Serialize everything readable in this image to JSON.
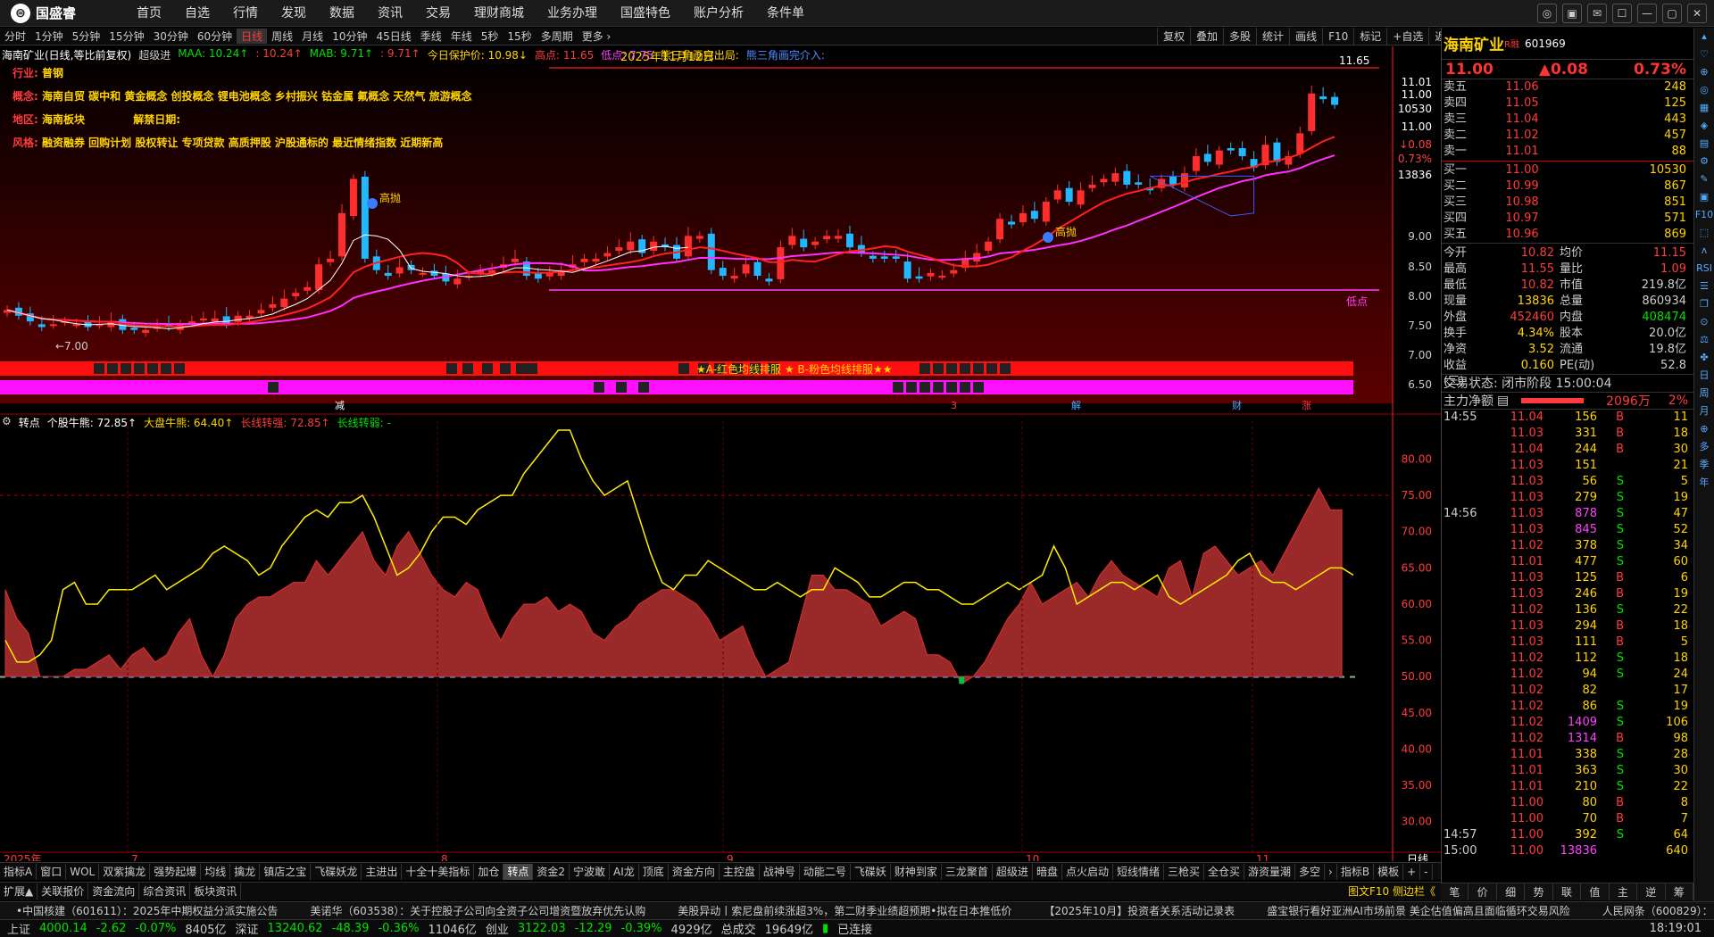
{
  "app": {
    "logo": "国盛睿",
    "menu": [
      "首页",
      "自选",
      "行情",
      "发现",
      "数据",
      "资讯",
      "交易",
      "理财商城",
      "业务办理",
      "国盛特色",
      "账户分析",
      "条件单"
    ]
  },
  "window_controls": [
    "◎",
    "▣",
    "✉",
    "☐",
    "—",
    "▢",
    "✕"
  ],
  "periods": [
    "分时",
    "1分钟",
    "5分钟",
    "15分钟",
    "30分钟",
    "60分钟",
    "日线",
    "周线",
    "月线",
    "10分钟",
    "45日线",
    "季线",
    "年线",
    "5秒",
    "15秒",
    "多周期",
    "更多 ›"
  ],
  "active_period": "日线",
  "chart_tools": [
    "复权",
    "叠加",
    "多股",
    "统计",
    "画线",
    "F10",
    "标记",
    "+自选",
    "返回"
  ],
  "header": {
    "name": "海南矿业(日线,等比前复权)",
    "indicator": "超级进",
    "maa": "MAA: 10.24↑",
    "maa2": ": 10.24↑",
    "mab": "MAB: 9.71↑",
    "mab2": ": 9.71↑",
    "protect": "今日保护价: 10.98↓",
    "high_label": "高点: 11.65",
    "low_label": "低点: 7.75",
    "tri1": "熊三角画完出局:",
    "tri2": "熊三角画完介入:"
  },
  "notes": {
    "industry_label": "行业:",
    "industry": "普钢",
    "concept_label": "概念:",
    "concept": "海南自贸 碳中和 黄金概念 创投概念 锂电池概念 乡村振兴 钴金属 氟概念 天然气 旅游概念",
    "region_label": "地区:",
    "region": "海南板块",
    "lift_label": "解禁日期:",
    "lift": "",
    "style_label": "风格:",
    "style": "融资融券 回购计划 股权转让 专项贷款 高质押股 沪股通标的 最近情绪指数 近期新高"
  },
  "chart_labels": {
    "date": "2025年11月12日",
    "high": "11.65",
    "low": "低点",
    "left_low": "←7.00",
    "gaoyao": "高抛",
    "banner": "★A-红色均线排服 ★ B-粉色均线排服★★",
    "marks": [
      "减",
      "3",
      "解",
      "财",
      "涨"
    ]
  },
  "price_axis": [
    "11.01",
    "11.00",
    "10530",
    "11.00",
    "↓0.08",
    "0.73%",
    "13836",
    "9.00",
    "8.50",
    "8.00",
    "7.50",
    "7.00",
    "6.50"
  ],
  "price_axis_colors": [
    "#fff",
    "#fff",
    "#fff",
    "#fff",
    "#ff4040",
    "#ff4040",
    "#fff",
    "#ccc",
    "#ccc",
    "#ccc",
    "#ccc",
    "#ccc",
    "#ccc"
  ],
  "indicator": {
    "name": "转点",
    "a": "个股牛熊: 72.85↑",
    "b": "大盘牛熊: 64.40↑",
    "c": "长线转强: 72.85↑",
    "d": "长线转弱: -"
  },
  "ind_axis": [
    "80.00",
    "75.00",
    "70.00",
    "65.00",
    "60.00",
    "55.00",
    "50.00",
    "45.00",
    "40.00",
    "35.00",
    "30.00"
  ],
  "months": [
    "2025年",
    "7",
    "8",
    "9",
    "10",
    "11"
  ],
  "period_corner": "日线",
  "chart_tabs": [
    "指标A",
    "窗口",
    "WOL",
    "双紫擒龙",
    "强势起爆",
    "均线",
    "擒龙",
    "镇店之宝",
    "飞碟妖龙",
    "主进出",
    "十全十美指标",
    "加仓",
    "转点",
    "资金2",
    "宁波敢",
    "AI龙",
    "顶底",
    "资金方向",
    "主控盘",
    "战神号",
    "动能二号",
    "飞碟妖",
    "财神到家",
    "三龙聚首",
    "超级进",
    "暗盘",
    "点火启动",
    "短线情绪",
    "三枪买",
    "全仓买",
    "游资量潮",
    "多空",
    "›",
    "指标B",
    "模板",
    "+",
    "-"
  ],
  "active_chart_tab": "转点",
  "footer_tabs": [
    "扩展▲",
    "关联报价",
    "资金流向",
    "综合资讯",
    "板块资讯"
  ],
  "footer_right": "图文F10 侧边栏《",
  "news": [
    "•中国核建（601611）：2025年中期权益分派实施公告",
    "美诺华（603538）：关于控股子公司向全资子公司增资暨放弃优先认购",
    "美股异动丨索尼盘前续涨超3%，第二财季业绩超预期•拟在日本推低价",
    "【2025年10月】投资者关系活动记录表",
    "盛宝银行看好亚洲AI市场前景 美企估值偏高且面临循环交易风险",
    "人民网条（600829）："
  ],
  "stat": {
    "sh_label": "上证",
    "sh": "4000.14",
    "sh_chg": "-2.62",
    "sh_pct": "-0.07%",
    "sh_amt": "8405亿",
    "sz_label": "深证",
    "sz": "13240.62",
    "sz_chg": "-48.39",
    "sz_pct": "-0.36%",
    "sz_amt": "11046亿",
    "cy_label": "创业",
    "cy": "3122.03",
    "cy_chg": "-12.29",
    "cy_pct": "-0.39%",
    "cy_amt": "4929亿",
    "total_label": "总成交",
    "total": "19649亿",
    "conn": "已连接",
    "time": "18:19:01"
  },
  "quote": {
    "name": "海南矿业",
    "tag": "R融",
    "code": "601969",
    "price": "11.00",
    "change": "▲0.08",
    "pct": "0.73%",
    "asks": [
      [
        "卖五",
        "11.06",
        "248"
      ],
      [
        "卖四",
        "11.05",
        "125"
      ],
      [
        "卖三",
        "11.04",
        "443"
      ],
      [
        "卖二",
        "11.02",
        "457"
      ],
      [
        "卖一",
        "11.01",
        "88"
      ]
    ],
    "bids": [
      [
        "买一",
        "11.00",
        "10530"
      ],
      [
        "买二",
        "10.99",
        "867"
      ],
      [
        "买三",
        "10.98",
        "851"
      ],
      [
        "买四",
        "10.97",
        "571"
      ],
      [
        "买五",
        "10.96",
        "869"
      ]
    ],
    "stats": [
      [
        "今开",
        "10.82",
        "均价",
        "11.15"
      ],
      [
        "最高",
        "11.55",
        "量比",
        "1.09"
      ],
      [
        "最低",
        "10.82",
        "市值",
        "219.8亿"
      ],
      [
        "现量",
        "13836",
        "总量",
        "860934"
      ],
      [
        "外盘",
        "452460",
        "内盘",
        "408474"
      ],
      [
        "换手",
        "4.34%",
        "股本",
        "20.0亿"
      ],
      [
        "净资",
        "3.52",
        "流通",
        "19.8亿"
      ],
      [
        "收益(三)",
        "0.160",
        "PE(动)",
        "52.8"
      ]
    ],
    "state": "交易状态: 闭市阶段 15:00:04",
    "zlj_label": "主力净额",
    "zlj": "2096万",
    "zlj_pct": "2%",
    "ticks": [
      [
        "14:55",
        "11.04",
        "156",
        "B",
        "11"
      ],
      [
        "",
        "11.03",
        "331",
        "B",
        "18"
      ],
      [
        "",
        "11.04",
        "244",
        "B",
        "30"
      ],
      [
        "",
        "11.03",
        "151",
        "",
        "21"
      ],
      [
        "",
        "11.03",
        "56",
        "S",
        "5"
      ],
      [
        "",
        "11.03",
        "279",
        "S",
        "19"
      ],
      [
        "14:56",
        "11.03",
        "878",
        "S",
        "47"
      ],
      [
        "",
        "11.03",
        "845",
        "S",
        "52"
      ],
      [
        "",
        "11.02",
        "378",
        "S",
        "34"
      ],
      [
        "",
        "11.01",
        "477",
        "S",
        "60"
      ],
      [
        "",
        "11.03",
        "125",
        "B",
        "6"
      ],
      [
        "",
        "11.03",
        "246",
        "B",
        "19"
      ],
      [
        "",
        "11.02",
        "136",
        "S",
        "22"
      ],
      [
        "",
        "11.03",
        "294",
        "B",
        "18"
      ],
      [
        "",
        "11.03",
        "111",
        "B",
        "5"
      ],
      [
        "",
        "11.02",
        "112",
        "S",
        "18"
      ],
      [
        "",
        "11.02",
        "94",
        "S",
        "24"
      ],
      [
        "",
        "11.02",
        "82",
        "",
        "17"
      ],
      [
        "",
        "11.02",
        "86",
        "S",
        "19"
      ],
      [
        "",
        "11.02",
        "1409",
        "S",
        "106"
      ],
      [
        "",
        "11.02",
        "1314",
        "B",
        "98"
      ],
      [
        "",
        "11.01",
        "338",
        "S",
        "28"
      ],
      [
        "",
        "11.01",
        "363",
        "S",
        "30"
      ],
      [
        "",
        "11.01",
        "210",
        "S",
        "22"
      ],
      [
        "",
        "11.00",
        "80",
        "B",
        "8"
      ],
      [
        "",
        "11.00",
        "70",
        "B",
        "7"
      ],
      [
        "14:57",
        "11.00",
        "392",
        "S",
        "64"
      ],
      [
        "15:00",
        "11.00",
        "13836",
        "",
        "640"
      ]
    ]
  },
  "side_tabs": [
    "笔",
    "价",
    "细",
    "势",
    "联",
    "值",
    "主",
    "逆",
    "筹"
  ],
  "right_toolbar": [
    "▴",
    "♡",
    "⊕",
    "◎",
    "▦",
    "◈",
    "▤",
    "⚙",
    "✎",
    "▣",
    "F10",
    "⬚",
    "ʌ",
    "RSI",
    "☰",
    "❐",
    "⊙",
    "⚖",
    "✤",
    "日",
    "周",
    "月",
    "⊕",
    "多",
    "季",
    "年"
  ],
  "chart_data": {
    "type": "candlestick",
    "period": "日线",
    "months": [
      "7",
      "8",
      "9",
      "10",
      "11"
    ],
    "price_range": [
      6.5,
      11.65
    ],
    "close": [
      7.4,
      7.3,
      7.2,
      7.1,
      7.15,
      7.2,
      7.15,
      7.1,
      7.15,
      7.2,
      7.05,
      7.05,
      7.05,
      7.1,
      7.1,
      7.15,
      7.2,
      7.25,
      7.25,
      7.15,
      7.3,
      7.3,
      7.4,
      7.5,
      7.6,
      7.7,
      7.8,
      8.2,
      8.3,
      9.1,
      9.7,
      8.3,
      8.1,
      8.0,
      8.15,
      8.1,
      8.05,
      8.0,
      7.9,
      7.95,
      8.0,
      8.1,
      8.1,
      8.2,
      8.3,
      8.0,
      7.95,
      8.05,
      8.1,
      8.2,
      8.3,
      8.3,
      8.4,
      8.5,
      8.6,
      8.4,
      8.6,
      8.5,
      8.3,
      8.7,
      8.7,
      8.1,
      8.0,
      8.0,
      8.2,
      8.0,
      7.9,
      8.5,
      8.7,
      8.5,
      8.6,
      8.7,
      8.7,
      8.5,
      8.4,
      8.3,
      8.3,
      8.3,
      7.95,
      7.95,
      8.05,
      8.0,
      8.1,
      8.3,
      8.4,
      8.6,
      9.0,
      8.9,
      9.1,
      9.0,
      9.3,
      9.5,
      9.3,
      9.5,
      9.6,
      9.7,
      9.8,
      9.6,
      9.6,
      9.5,
      9.7,
      9.6,
      9.8,
      10.1,
      10.0,
      10.2,
      10.2,
      10.1,
      9.9,
      10.3,
      10.0,
      10.1,
      10.5,
      11.2,
      11.1,
      11.0
    ],
    "ma_a_last": 10.24,
    "ma_b_last": 9.71,
    "indicator": {
      "series": [
        {
          "name": "个股牛熊",
          "last": 72.85
        },
        {
          "name": "大盘牛熊",
          "last": 64.4
        }
      ],
      "ylim": [
        27,
        84
      ],
      "threshold": 50,
      "a": [
        62,
        58,
        56,
        50,
        50,
        50,
        51,
        51,
        52,
        53,
        51,
        53,
        54,
        52,
        53,
        56,
        58,
        53,
        50,
        53,
        58,
        60,
        61,
        61,
        62,
        63,
        63,
        66,
        64,
        66,
        68,
        70,
        66,
        64,
        68,
        70,
        67,
        64,
        62,
        61,
        63,
        62,
        58,
        55,
        58,
        60,
        60,
        61,
        59,
        60,
        59,
        56,
        55,
        57,
        58,
        60,
        61,
        62,
        62,
        61,
        60,
        58,
        55,
        56,
        57,
        53,
        50,
        51,
        52,
        58,
        64,
        64,
        62,
        62,
        61,
        60,
        57,
        58,
        59,
        58,
        53,
        53,
        52,
        49,
        50,
        52,
        55,
        58,
        60,
        63,
        60,
        61,
        62,
        63,
        61,
        64,
        66,
        64,
        63,
        62,
        61,
        65,
        66,
        61,
        67,
        68,
        66,
        64,
        65,
        66,
        64,
        67,
        70,
        73,
        76,
        73,
        73
      ],
      "b": [
        55,
        52,
        52,
        53,
        55,
        62,
        63,
        60,
        60,
        62,
        62,
        62,
        63,
        64,
        62,
        63,
        64,
        65,
        67,
        68,
        67,
        66,
        64,
        65,
        68,
        70,
        72,
        73,
        72,
        74,
        74,
        75,
        72,
        68,
        64,
        65,
        67,
        70,
        72,
        72,
        71,
        73,
        74,
        75,
        75,
        78,
        80,
        82,
        84,
        84,
        80,
        77,
        75,
        76,
        77,
        72,
        67,
        63,
        62,
        64,
        64,
        66,
        65,
        64,
        63,
        62,
        62,
        63,
        62,
        61,
        62,
        62,
        65,
        64,
        63,
        61,
        61,
        62,
        63,
        63,
        62,
        62,
        61,
        60,
        60,
        61,
        62,
        63,
        62,
        63,
        64,
        68,
        65,
        60,
        61,
        62,
        63,
        63,
        62,
        63,
        64,
        61,
        60,
        61,
        62,
        63,
        64,
        66,
        67,
        64,
        63,
        63,
        62,
        63,
        64,
        65,
        65,
        64
      ]
    }
  }
}
